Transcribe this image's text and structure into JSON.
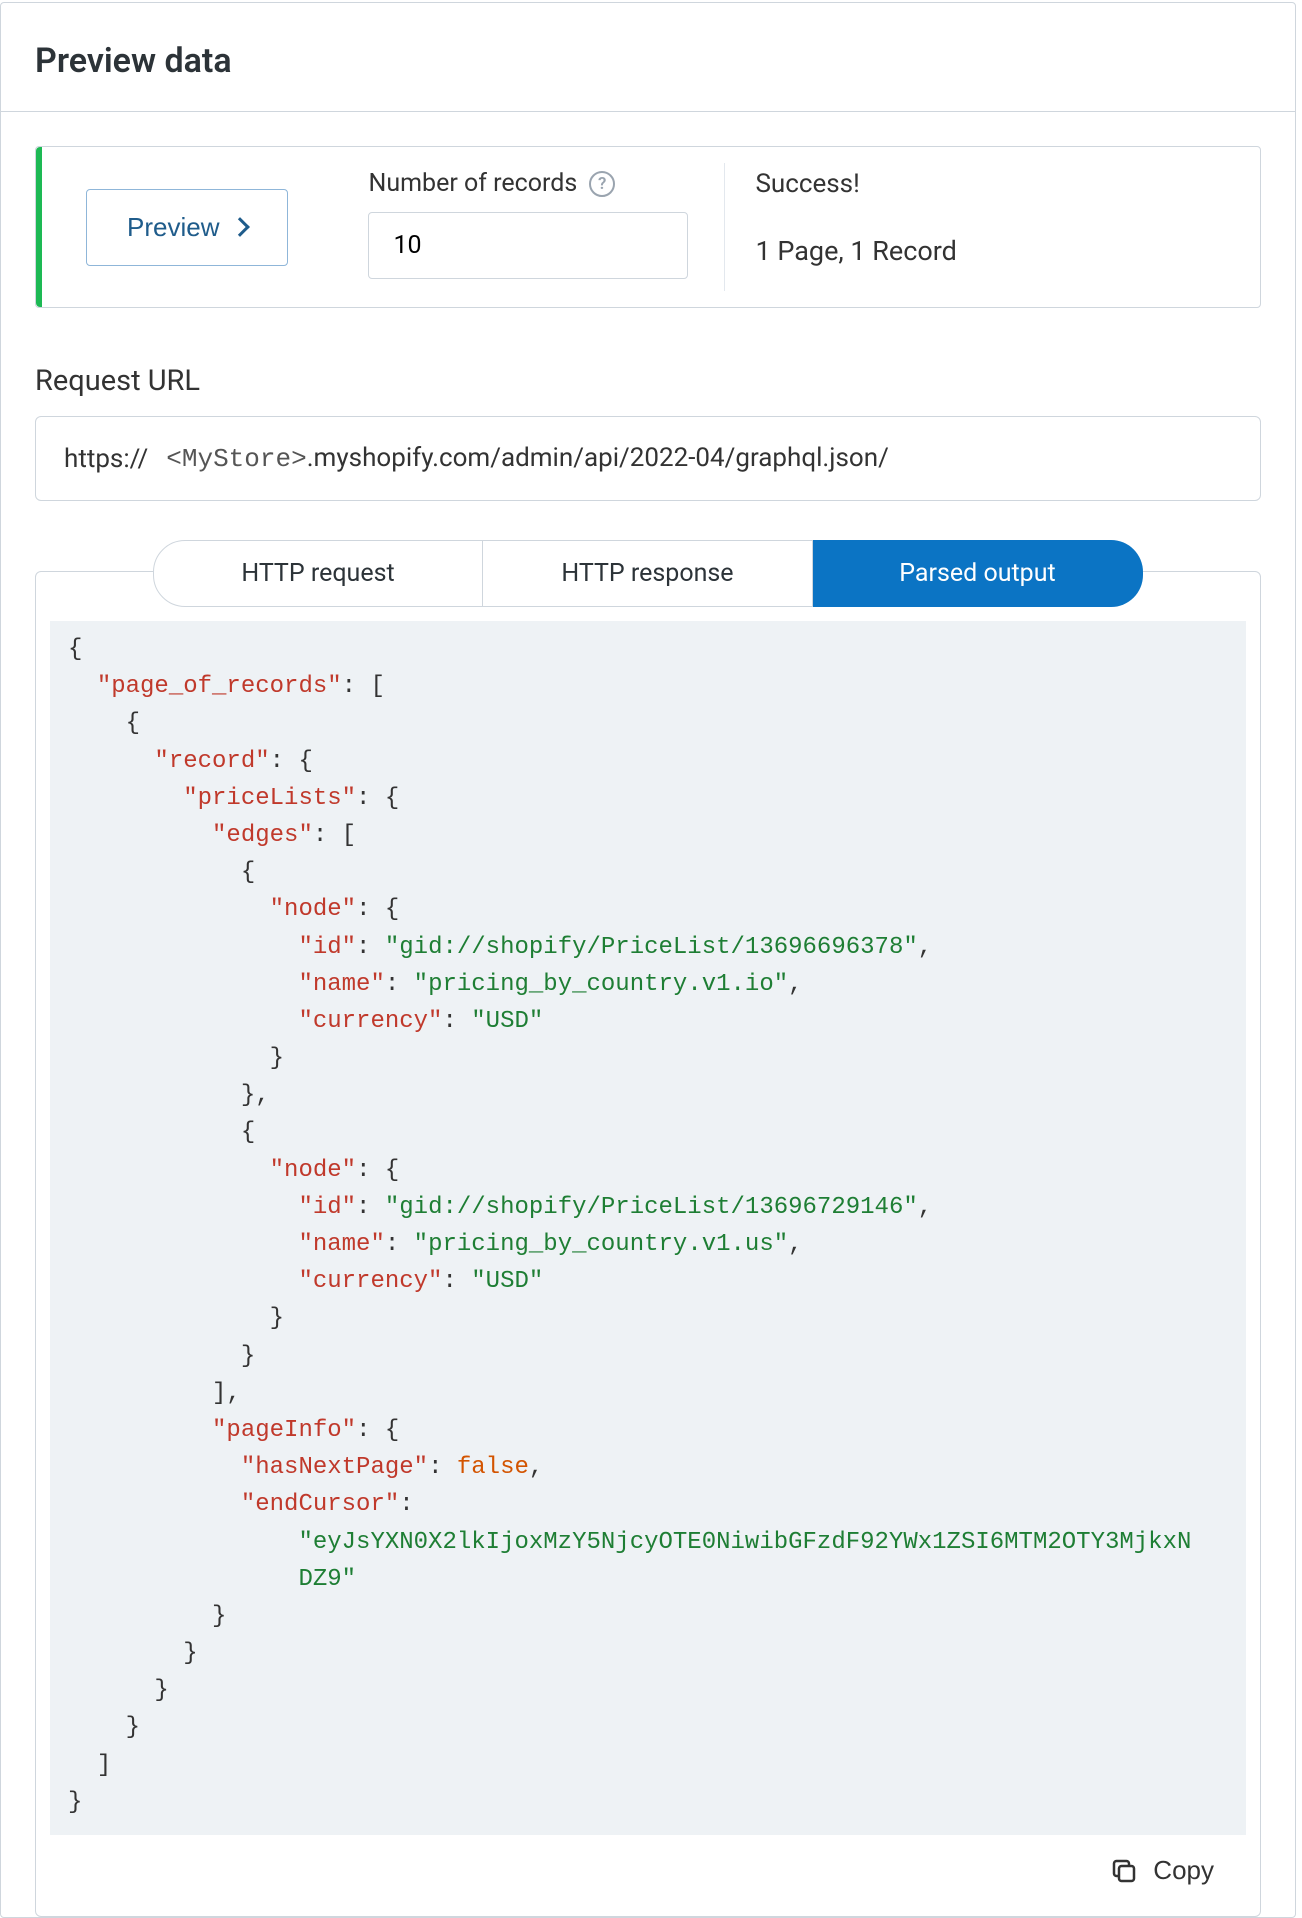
{
  "header": {
    "title": "Preview data"
  },
  "preview": {
    "button_label": "Preview",
    "records_label": "Number of records",
    "records_value": "10",
    "status_title": "Success!",
    "status_detail": "1 Page, 1 Record"
  },
  "request_url": {
    "section_title": "Request URL",
    "scheme": "https://",
    "placeholder_token": "<MyStore>",
    "path": ".myshopify.com/admin/api/2022-04/graphql.json/"
  },
  "tabs": {
    "http_request": "HTTP request",
    "http_response": "HTTP response",
    "parsed_output": "Parsed output",
    "active": "parsed_output"
  },
  "copy": {
    "label": "Copy"
  },
  "code": {
    "k_page_of_records": "\"page_of_records\"",
    "k_record": "\"record\"",
    "k_priceLists": "\"priceLists\"",
    "k_edges": "\"edges\"",
    "k_node": "\"node\"",
    "k_id": "\"id\"",
    "k_name": "\"name\"",
    "k_currency": "\"currency\"",
    "k_pageInfo": "\"pageInfo\"",
    "k_hasNextPage": "\"hasNextPage\"",
    "k_endCursor": "\"endCursor\"",
    "v_id1": "\"gid://shopify/PriceList/13696696378\"",
    "v_name1": "\"pricing_by_country.v1.io\"",
    "v_id2": "\"gid://shopify/PriceList/13696729146\"",
    "v_name2": "\"pricing_by_country.v1.us\"",
    "v_usd": "\"USD\"",
    "v_false": "false",
    "v_cursor_line1": "\"eyJsYXN0X2lkIjoxMzY5NjcyOTE0NiwibGFzdF92YWx1ZSI6MTM2OTY3MjkxN",
    "v_cursor_line2": "DZ9\""
  }
}
